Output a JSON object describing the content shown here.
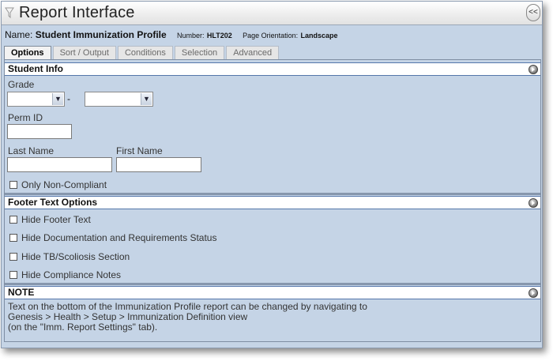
{
  "window": {
    "title": "Report Interface",
    "collapse_label": "<<"
  },
  "report": {
    "name_label": "Name:",
    "name_value": "Student Immunization Profile",
    "number_label": "Number:",
    "number_value": "HLT202",
    "orientation_label": "Page Orientation:",
    "orientation_value": "Landscape"
  },
  "tabs": [
    {
      "label": "Options",
      "active": true
    },
    {
      "label": "Sort / Output",
      "active": false
    },
    {
      "label": "Conditions",
      "active": false
    },
    {
      "label": "Selection",
      "active": false
    },
    {
      "label": "Advanced",
      "active": false
    }
  ],
  "student_info": {
    "header": "Student Info",
    "grade_label": "Grade",
    "grade_from_value": "",
    "grade_separator": "-",
    "grade_to_value": "",
    "perm_id_label": "Perm ID",
    "perm_id_value": "",
    "last_name_label": "Last Name",
    "last_name_value": "",
    "first_name_label": "First Name",
    "first_name_value": "",
    "only_non_compliant_label": "Only Non-Compliant",
    "only_non_compliant_checked": false
  },
  "footer_options": {
    "header": "Footer Text Options",
    "items": [
      {
        "label": "Hide Footer Text",
        "checked": false
      },
      {
        "label": "Hide Documentation and Requirements Status",
        "checked": false
      },
      {
        "label": "Hide TB/Scoliosis Section",
        "checked": false
      },
      {
        "label": "Hide Compliance Notes",
        "checked": false
      }
    ]
  },
  "note": {
    "header": "NOTE",
    "lines": [
      "Text on the bottom of the Immunization Profile report can be changed by navigating to",
      "Genesis > Health > Setup > Immunization Definition view",
      "(on the \"Imm. Report Settings\" tab)."
    ]
  },
  "icons": {
    "title": "filter-funnel-icon",
    "collapse": "double-chevron-left-icon",
    "section_toggle": "circle-arrow-icon",
    "dropdown": "chevron-down-icon"
  }
}
